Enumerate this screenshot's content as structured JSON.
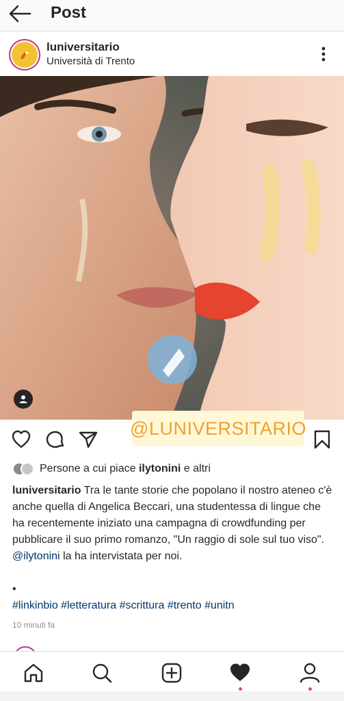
{
  "topbar": {
    "title": "Post"
  },
  "post": {
    "username": "luniversitario",
    "location": "Università di Trento",
    "watermark": "@LUNIVERSITARIO",
    "likes": {
      "prefix": "Persone a cui piace",
      "user": "ilytonini",
      "suffix": "e altri"
    },
    "caption": {
      "author": "luniversitario",
      "text": "Tra le tante storie che popolano il nostro ateneo c'è anche quella di Angelica Beccari, una studentessa di lingue che ha recentemente iniziato una campagna di crowdfunding per pubblicare il suo primo romanzo, \"Un raggio di sole sul tuo viso\".",
      "mention": "@ilytonini",
      "text_end": "la ha intervistata per noi."
    },
    "dot": "•",
    "hashtags": [
      "#linkinbio",
      "#letteratura",
      "#scrittura",
      "#trento",
      "#unitn"
    ],
    "time": "10 minuti fa"
  },
  "icons": {
    "back": "arrow-left-icon",
    "more": "more-vertical-icon",
    "like": "heart-outline-icon",
    "comment": "comment-icon",
    "share": "paper-plane-icon",
    "save": "bookmark-icon",
    "tag": "user-tag-icon",
    "home": "home-icon",
    "search": "search-icon",
    "add": "add-post-icon",
    "activity": "heart-filled-icon",
    "profile": "profile-icon"
  },
  "colors": {
    "link": "#00376b",
    "watermark_text": "#f0a030",
    "watermark_bg": "#fff8d8",
    "avatar_bg": "#f1c232",
    "story_ring": "#c13584",
    "notification": "#ed4956"
  }
}
